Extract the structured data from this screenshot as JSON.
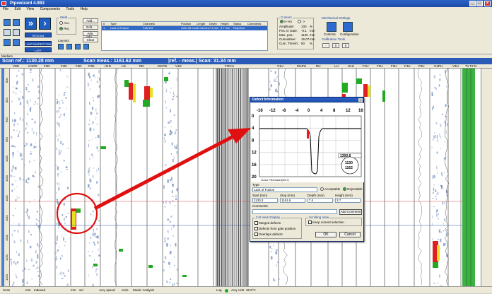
{
  "window": {
    "title": "Pipewizard 4.0B3"
  },
  "menu": [
    "File",
    "Edit",
    "View",
    "Components",
    "Tools",
    "Help"
  ],
  "toolbar": {
    "weld_label": "Weld",
    "weld_options": [
      "Acc.",
      "Rej."
    ],
    "layouts_label": "Layouts",
    "add_label": "Add...",
    "edit_label": "Edit...",
    "ade_info_label": "Ade. Info...",
    "clear_label": "Clear",
    "rescan_label": "RESCAN",
    "last_inspection_label": "LAST INSPECTION",
    "last_calibration_label": "LAST CALIBRATION"
  },
  "defect_table": {
    "headers": [
      "#",
      "Type",
      "Channels",
      "Position",
      "Length",
      "Depth",
      "Height",
      "Status",
      "Comments"
    ],
    "row": [
      "1",
      "Lack of Fusion",
      "F4M D3",
      "1130.39 mm",
      "31.66 mm",
      "7.4 mm",
      "3.7 mm",
      "Rejected",
      ""
    ]
  },
  "cursors": {
    "title": "Cursors",
    "options": [
      "Ir->I4",
      "->"
    ],
    "rows": [
      {
        "label": "Amplitude:",
        "value": "100",
        "unit": "%"
      },
      {
        "label": "Pos. in Gate:",
        "value": "-0.1",
        "unit": "mm"
      },
      {
        "label": "Max. pos.:",
        "value": "1140",
        "unit": "mm"
      },
      {
        "label": "Cumulative:",
        "value": "16.07",
        "unit": "mm"
      },
      {
        "label": "Cum. Thresh.:",
        "value": "50",
        "unit": "%"
      }
    ]
  },
  "mech": {
    "title": "Mechanical Settings",
    "controls_label": "Controls",
    "config_label": "Configuration"
  },
  "calib": {
    "title": "Calibration Tools",
    "fields": [
      "-",
      "0",
      "0"
    ]
  },
  "medium_label": "Medium",
  "scanbar": {
    "scan_ref": "Scan ref.: 1130.28 mm",
    "scan_meas": "Scan meas.: 1161.62 mm",
    "ref_meas": "|ref. - meas.| Scan: 31.34 mm"
  },
  "channels": [
    "V3D",
    "CAPD",
    "F3D",
    "F4D",
    "F3D",
    "F2D",
    "H1D",
    "LD",
    "RD",
    "MAPD",
    "V1D",
    "FOCU",
    "V1U",
    "MAPU",
    "RU",
    "LU",
    "H1U",
    "F1U",
    "F2U",
    "F3U",
    "F4U",
    "F5U",
    "C4PU",
    "V3U",
    "T1 T2 N"
  ],
  "ruler_ticks": [
    "800",
    "850",
    "900",
    "950",
    "1000",
    "1050",
    "1100",
    "1150",
    "1200",
    "1250",
    "1300"
  ],
  "status": {
    "scan": "Scan",
    "speed": "mm",
    "indexed": "Indexed",
    "mm2": "mm",
    "sel": "sel",
    "acquisition": "Acq. speed",
    "speed_unit": "cm/s",
    "mode": "Mode: Analysis",
    "log": "Log",
    "acq_unit": "Acq. Unit",
    "temp": "36.9°C"
  },
  "dialog": {
    "title": "Defect Information",
    "xticks": [
      "-16",
      "-12",
      "-8",
      "-4",
      "0",
      "4",
      "8",
      "12",
      "16"
    ],
    "yticks": [
      "0",
      "4",
      "8",
      "12",
      "16",
      "20"
    ],
    "plot_caption": "Cursor: Pipewizard(2017)",
    "box_top": "1300.8",
    "box_mid": "1130",
    "box_bot": "1162",
    "type_label": "Type",
    "type_value": "Lack of Fusion",
    "acceptable_label": "Acceptable",
    "rejectable_label": "Rejectable",
    "start_label": "Start (mm)",
    "stop_label": "Stop (mm)",
    "depth_label": "Depth (mm)",
    "height_label": "Height (mm)",
    "start_value": "1130.3",
    "stop_value": "1161.6",
    "depth_value": "7.4",
    "height_value": "3.7",
    "comments_label": "Comments",
    "add_comment_label": "Add Comment",
    "view_title": "2-D View Display",
    "scroll_title": "Scrolling View",
    "merged_label": "Merged defects",
    "gate_label": "Defects from gate position",
    "overlaps_label": "Overlaps defects",
    "keep_label": "Keep current selection",
    "ok_label": "OK",
    "cancel_label": "Cancel"
  },
  "colors": {
    "accent": "#1f55b4",
    "defect_red": "#e02020",
    "defect_green": "#22aa22",
    "defect_yellow": "#e8e020",
    "arrow": "#e01010"
  }
}
